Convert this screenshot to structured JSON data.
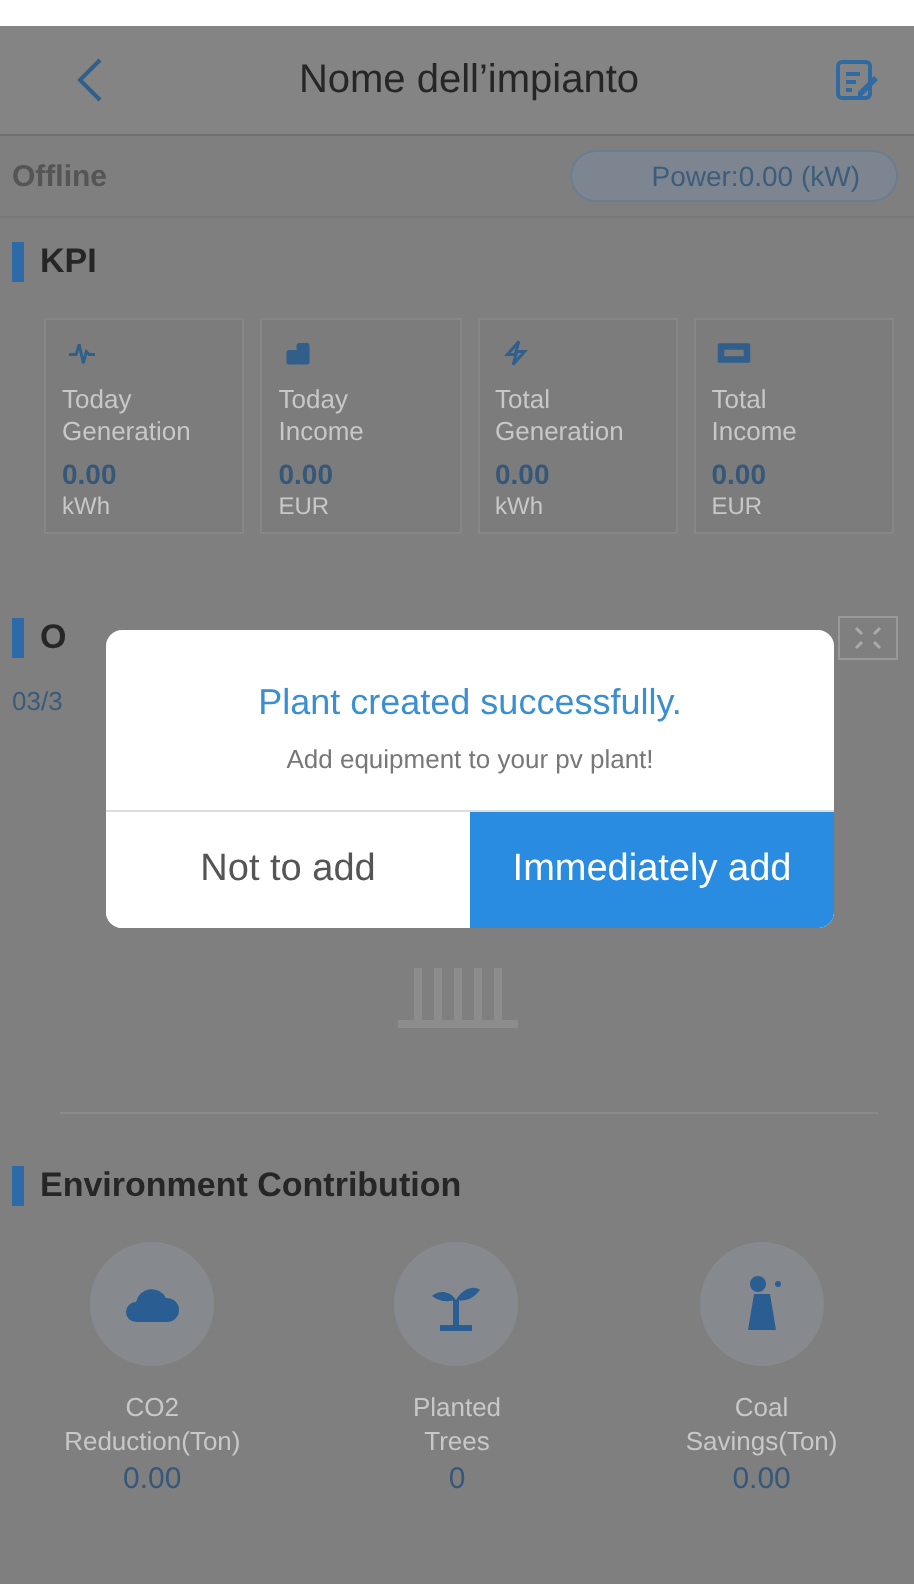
{
  "header": {
    "title": "Nome dell’impianto"
  },
  "status": {
    "state": "Offline",
    "power": "Power:0.00 (kW)"
  },
  "kpi": {
    "title": "KPI",
    "cards": [
      {
        "kind": "pulse",
        "label": "Today Generation",
        "value": "0.00",
        "unit": "kWh"
      },
      {
        "kind": "coins",
        "label": "Today Income",
        "value": "0.00",
        "unit": "EUR"
      },
      {
        "kind": "bolt",
        "label": "Total Generation",
        "value": "0.00",
        "unit": "kWh"
      },
      {
        "kind": "cash",
        "label": "Total Income",
        "value": "0.00",
        "unit": "EUR"
      }
    ]
  },
  "overview": {
    "title": "O",
    "date": "03/3"
  },
  "dialog": {
    "title": "Plant created successfully.",
    "message": "Add equipment to your pv plant!",
    "buttons": [
      {
        "label": "Not to add",
        "primary": false
      },
      {
        "label": "Immediately add",
        "primary": true
      }
    ]
  },
  "environment": {
    "title": "Environment Contribution",
    "items": [
      {
        "kind": "cloud",
        "label": "CO2 Reduction(Ton)",
        "value": "0.00"
      },
      {
        "kind": "plant",
        "label": "Planted Trees",
        "value": "0"
      },
      {
        "kind": "factory",
        "label": "Coal Savings(Ton)",
        "value": "0.00"
      }
    ]
  }
}
